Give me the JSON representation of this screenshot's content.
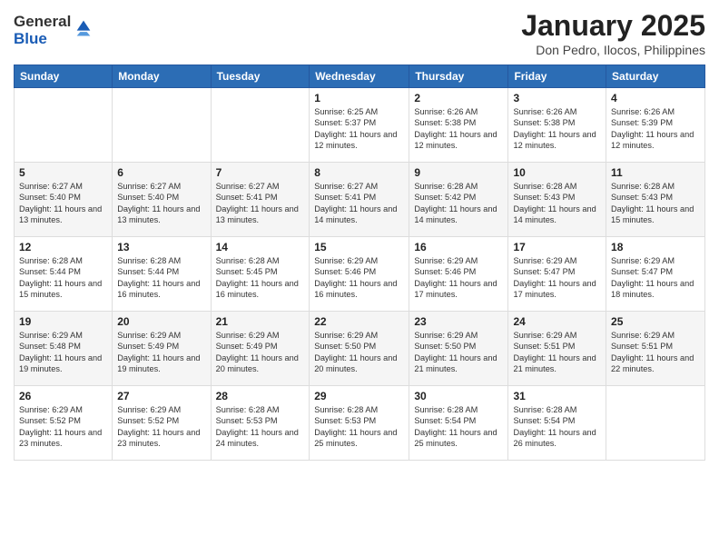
{
  "logo": {
    "general": "General",
    "blue": "Blue"
  },
  "title": "January 2025",
  "location": "Don Pedro, Ilocos, Philippines",
  "days": [
    "Sunday",
    "Monday",
    "Tuesday",
    "Wednesday",
    "Thursday",
    "Friday",
    "Saturday"
  ],
  "weeks": [
    [
      {
        "day": "",
        "sunrise": "",
        "sunset": "",
        "daylight": ""
      },
      {
        "day": "",
        "sunrise": "",
        "sunset": "",
        "daylight": ""
      },
      {
        "day": "",
        "sunrise": "",
        "sunset": "",
        "daylight": ""
      },
      {
        "day": "1",
        "sunrise": "Sunrise: 6:25 AM",
        "sunset": "Sunset: 5:37 PM",
        "daylight": "Daylight: 11 hours and 12 minutes."
      },
      {
        "day": "2",
        "sunrise": "Sunrise: 6:26 AM",
        "sunset": "Sunset: 5:38 PM",
        "daylight": "Daylight: 11 hours and 12 minutes."
      },
      {
        "day": "3",
        "sunrise": "Sunrise: 6:26 AM",
        "sunset": "Sunset: 5:38 PM",
        "daylight": "Daylight: 11 hours and 12 minutes."
      },
      {
        "day": "4",
        "sunrise": "Sunrise: 6:26 AM",
        "sunset": "Sunset: 5:39 PM",
        "daylight": "Daylight: 11 hours and 12 minutes."
      }
    ],
    [
      {
        "day": "5",
        "sunrise": "Sunrise: 6:27 AM",
        "sunset": "Sunset: 5:40 PM",
        "daylight": "Daylight: 11 hours and 13 minutes."
      },
      {
        "day": "6",
        "sunrise": "Sunrise: 6:27 AM",
        "sunset": "Sunset: 5:40 PM",
        "daylight": "Daylight: 11 hours and 13 minutes."
      },
      {
        "day": "7",
        "sunrise": "Sunrise: 6:27 AM",
        "sunset": "Sunset: 5:41 PM",
        "daylight": "Daylight: 11 hours and 13 minutes."
      },
      {
        "day": "8",
        "sunrise": "Sunrise: 6:27 AM",
        "sunset": "Sunset: 5:41 PM",
        "daylight": "Daylight: 11 hours and 14 minutes."
      },
      {
        "day": "9",
        "sunrise": "Sunrise: 6:28 AM",
        "sunset": "Sunset: 5:42 PM",
        "daylight": "Daylight: 11 hours and 14 minutes."
      },
      {
        "day": "10",
        "sunrise": "Sunrise: 6:28 AM",
        "sunset": "Sunset: 5:43 PM",
        "daylight": "Daylight: 11 hours and 14 minutes."
      },
      {
        "day": "11",
        "sunrise": "Sunrise: 6:28 AM",
        "sunset": "Sunset: 5:43 PM",
        "daylight": "Daylight: 11 hours and 15 minutes."
      }
    ],
    [
      {
        "day": "12",
        "sunrise": "Sunrise: 6:28 AM",
        "sunset": "Sunset: 5:44 PM",
        "daylight": "Daylight: 11 hours and 15 minutes."
      },
      {
        "day": "13",
        "sunrise": "Sunrise: 6:28 AM",
        "sunset": "Sunset: 5:44 PM",
        "daylight": "Daylight: 11 hours and 16 minutes."
      },
      {
        "day": "14",
        "sunrise": "Sunrise: 6:28 AM",
        "sunset": "Sunset: 5:45 PM",
        "daylight": "Daylight: 11 hours and 16 minutes."
      },
      {
        "day": "15",
        "sunrise": "Sunrise: 6:29 AM",
        "sunset": "Sunset: 5:46 PM",
        "daylight": "Daylight: 11 hours and 16 minutes."
      },
      {
        "day": "16",
        "sunrise": "Sunrise: 6:29 AM",
        "sunset": "Sunset: 5:46 PM",
        "daylight": "Daylight: 11 hours and 17 minutes."
      },
      {
        "day": "17",
        "sunrise": "Sunrise: 6:29 AM",
        "sunset": "Sunset: 5:47 PM",
        "daylight": "Daylight: 11 hours and 17 minutes."
      },
      {
        "day": "18",
        "sunrise": "Sunrise: 6:29 AM",
        "sunset": "Sunset: 5:47 PM",
        "daylight": "Daylight: 11 hours and 18 minutes."
      }
    ],
    [
      {
        "day": "19",
        "sunrise": "Sunrise: 6:29 AM",
        "sunset": "Sunset: 5:48 PM",
        "daylight": "Daylight: 11 hours and 19 minutes."
      },
      {
        "day": "20",
        "sunrise": "Sunrise: 6:29 AM",
        "sunset": "Sunset: 5:49 PM",
        "daylight": "Daylight: 11 hours and 19 minutes."
      },
      {
        "day": "21",
        "sunrise": "Sunrise: 6:29 AM",
        "sunset": "Sunset: 5:49 PM",
        "daylight": "Daylight: 11 hours and 20 minutes."
      },
      {
        "day": "22",
        "sunrise": "Sunrise: 6:29 AM",
        "sunset": "Sunset: 5:50 PM",
        "daylight": "Daylight: 11 hours and 20 minutes."
      },
      {
        "day": "23",
        "sunrise": "Sunrise: 6:29 AM",
        "sunset": "Sunset: 5:50 PM",
        "daylight": "Daylight: 11 hours and 21 minutes."
      },
      {
        "day": "24",
        "sunrise": "Sunrise: 6:29 AM",
        "sunset": "Sunset: 5:51 PM",
        "daylight": "Daylight: 11 hours and 21 minutes."
      },
      {
        "day": "25",
        "sunrise": "Sunrise: 6:29 AM",
        "sunset": "Sunset: 5:51 PM",
        "daylight": "Daylight: 11 hours and 22 minutes."
      }
    ],
    [
      {
        "day": "26",
        "sunrise": "Sunrise: 6:29 AM",
        "sunset": "Sunset: 5:52 PM",
        "daylight": "Daylight: 11 hours and 23 minutes."
      },
      {
        "day": "27",
        "sunrise": "Sunrise: 6:29 AM",
        "sunset": "Sunset: 5:52 PM",
        "daylight": "Daylight: 11 hours and 23 minutes."
      },
      {
        "day": "28",
        "sunrise": "Sunrise: 6:28 AM",
        "sunset": "Sunset: 5:53 PM",
        "daylight": "Daylight: 11 hours and 24 minutes."
      },
      {
        "day": "29",
        "sunrise": "Sunrise: 6:28 AM",
        "sunset": "Sunset: 5:53 PM",
        "daylight": "Daylight: 11 hours and 25 minutes."
      },
      {
        "day": "30",
        "sunrise": "Sunrise: 6:28 AM",
        "sunset": "Sunset: 5:54 PM",
        "daylight": "Daylight: 11 hours and 25 minutes."
      },
      {
        "day": "31",
        "sunrise": "Sunrise: 6:28 AM",
        "sunset": "Sunset: 5:54 PM",
        "daylight": "Daylight: 11 hours and 26 minutes."
      },
      {
        "day": "",
        "sunrise": "",
        "sunset": "",
        "daylight": ""
      }
    ]
  ]
}
